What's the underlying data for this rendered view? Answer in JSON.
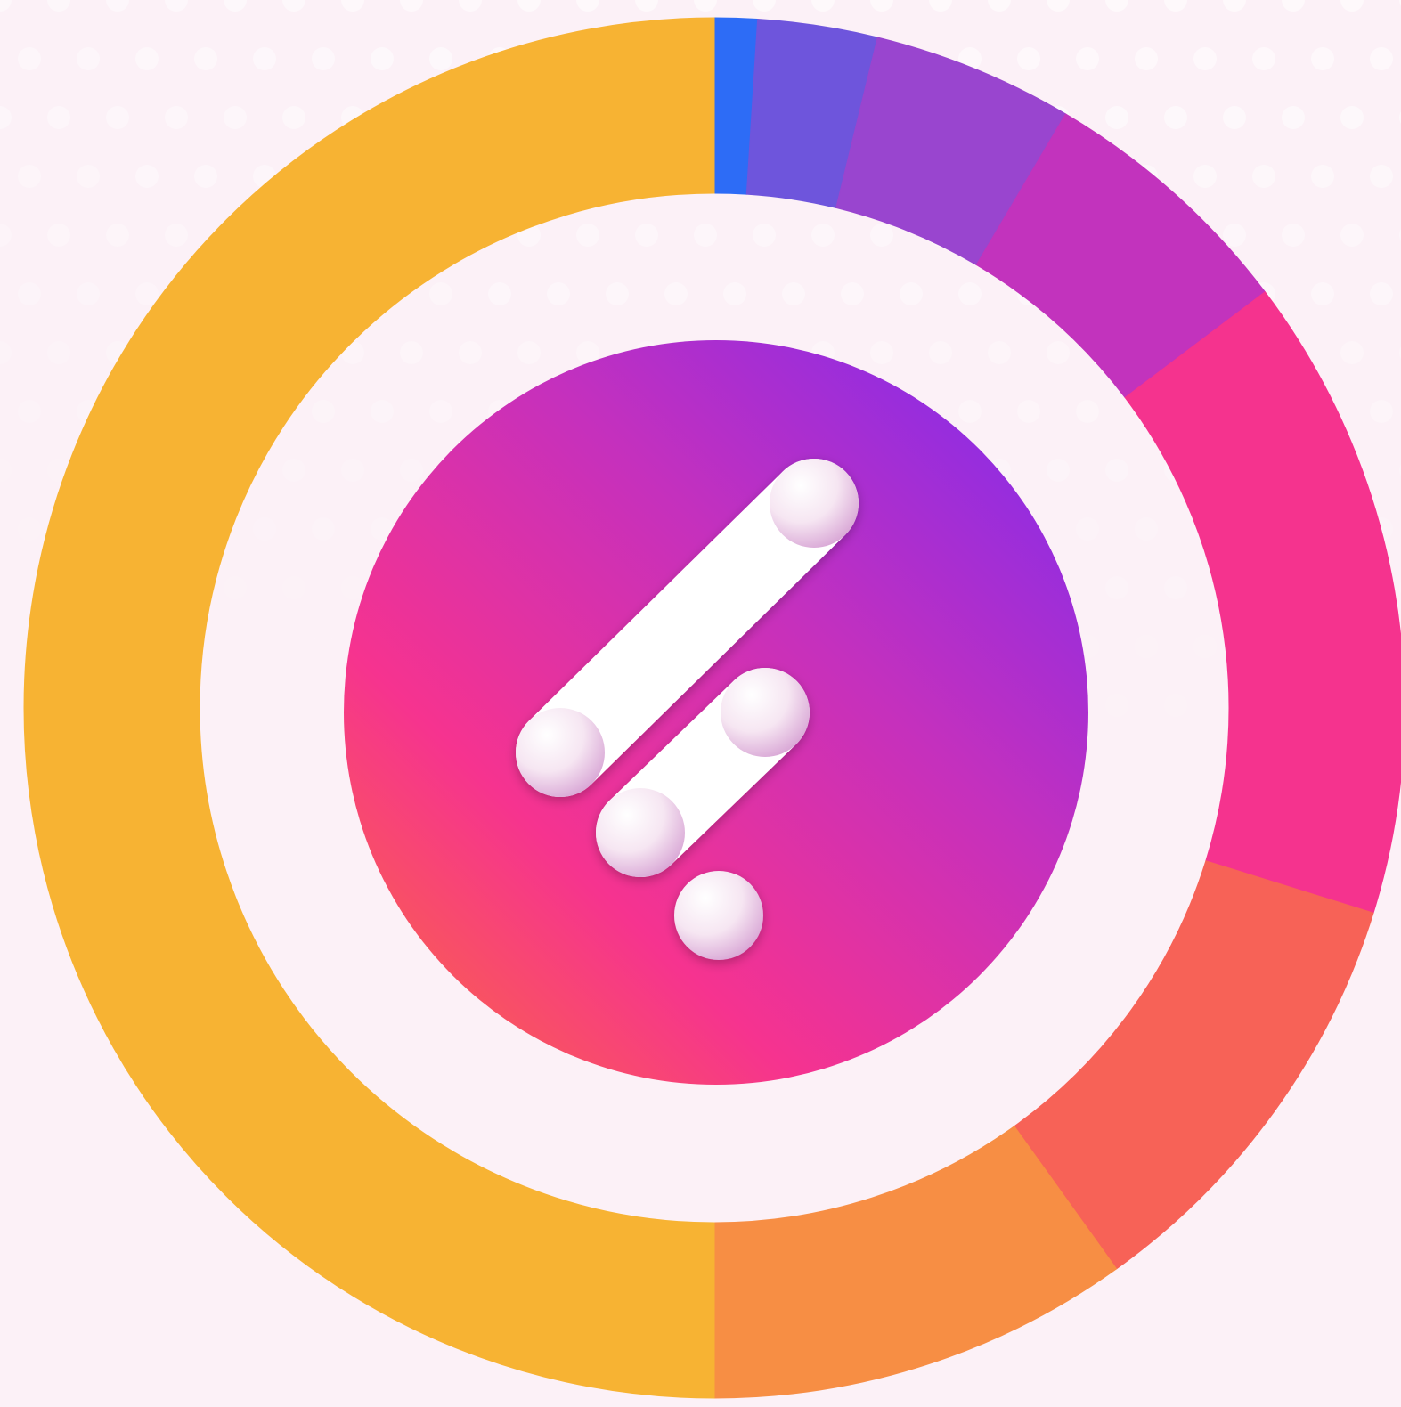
{
  "chart_data": {
    "type": "donut",
    "title": "",
    "legend": "none",
    "start_angle": "top",
    "direction": "clockwise",
    "slices": [
      {
        "value": 1.0,
        "color": "#2d6cf6"
      },
      {
        "value": 2.8,
        "color": "#6e55dc"
      },
      {
        "value": 4.7,
        "color": "#9945cf"
      },
      {
        "value": 6.2,
        "color": "#c233bd"
      },
      {
        "value": 15.1,
        "color": "#f5338e"
      },
      {
        "value": 10.3,
        "color": "#f76257"
      },
      {
        "value": 9.9,
        "color": "#f78e44"
      },
      {
        "value": 50.0,
        "color": "#f7b333"
      }
    ]
  },
  "logo": {
    "icon": "app-logo-icon",
    "gradient": [
      "#8a2ce6",
      "#c530bd",
      "#f6338f",
      "#f9555e"
    ]
  },
  "background": {
    "color": "#fcf1f7",
    "pattern": "white-dots"
  }
}
